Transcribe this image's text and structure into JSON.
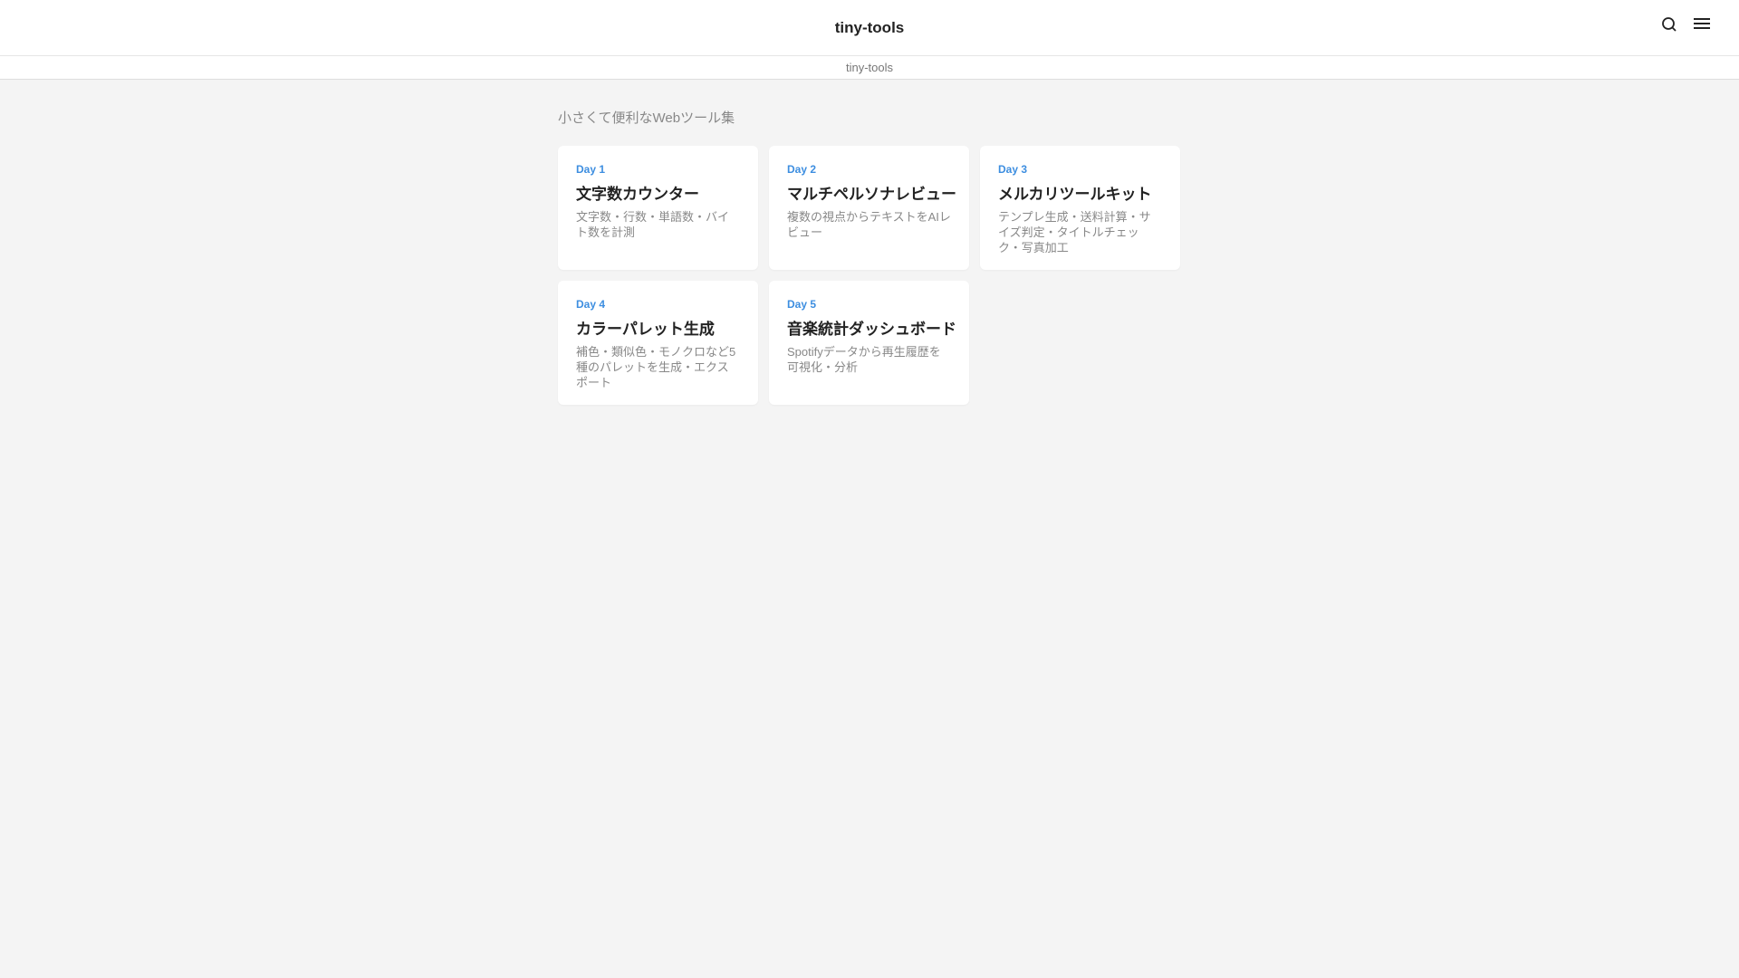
{
  "header": {
    "title": "tiny-tools",
    "search_icon": "search-icon",
    "menu_icon": "menu-icon"
  },
  "breadcrumb": "tiny-tools",
  "tagline": "小さくて便利なWebツール集",
  "cards": [
    {
      "day": "Day 1",
      "title": "文字数カウンター",
      "desc": "文字数・行数・単語数・バイト数を計測"
    },
    {
      "day": "Day 2",
      "title": "マルチペルソナレビュー",
      "desc": "複数の視点からテキストをAIレビュー"
    },
    {
      "day": "Day 3",
      "title": "メルカリツールキット",
      "desc": "テンプレ生成・送料計算・サイズ判定・タイトルチェック・写真加工"
    },
    {
      "day": "Day 4",
      "title": "カラーパレット生成",
      "desc": "補色・類似色・モノクロなど5種のパレットを生成・エクスポート"
    },
    {
      "day": "Day 5",
      "title": "音楽統計ダッシュボード",
      "desc": "Spotifyデータから再生履歴を可視化・分析"
    }
  ]
}
